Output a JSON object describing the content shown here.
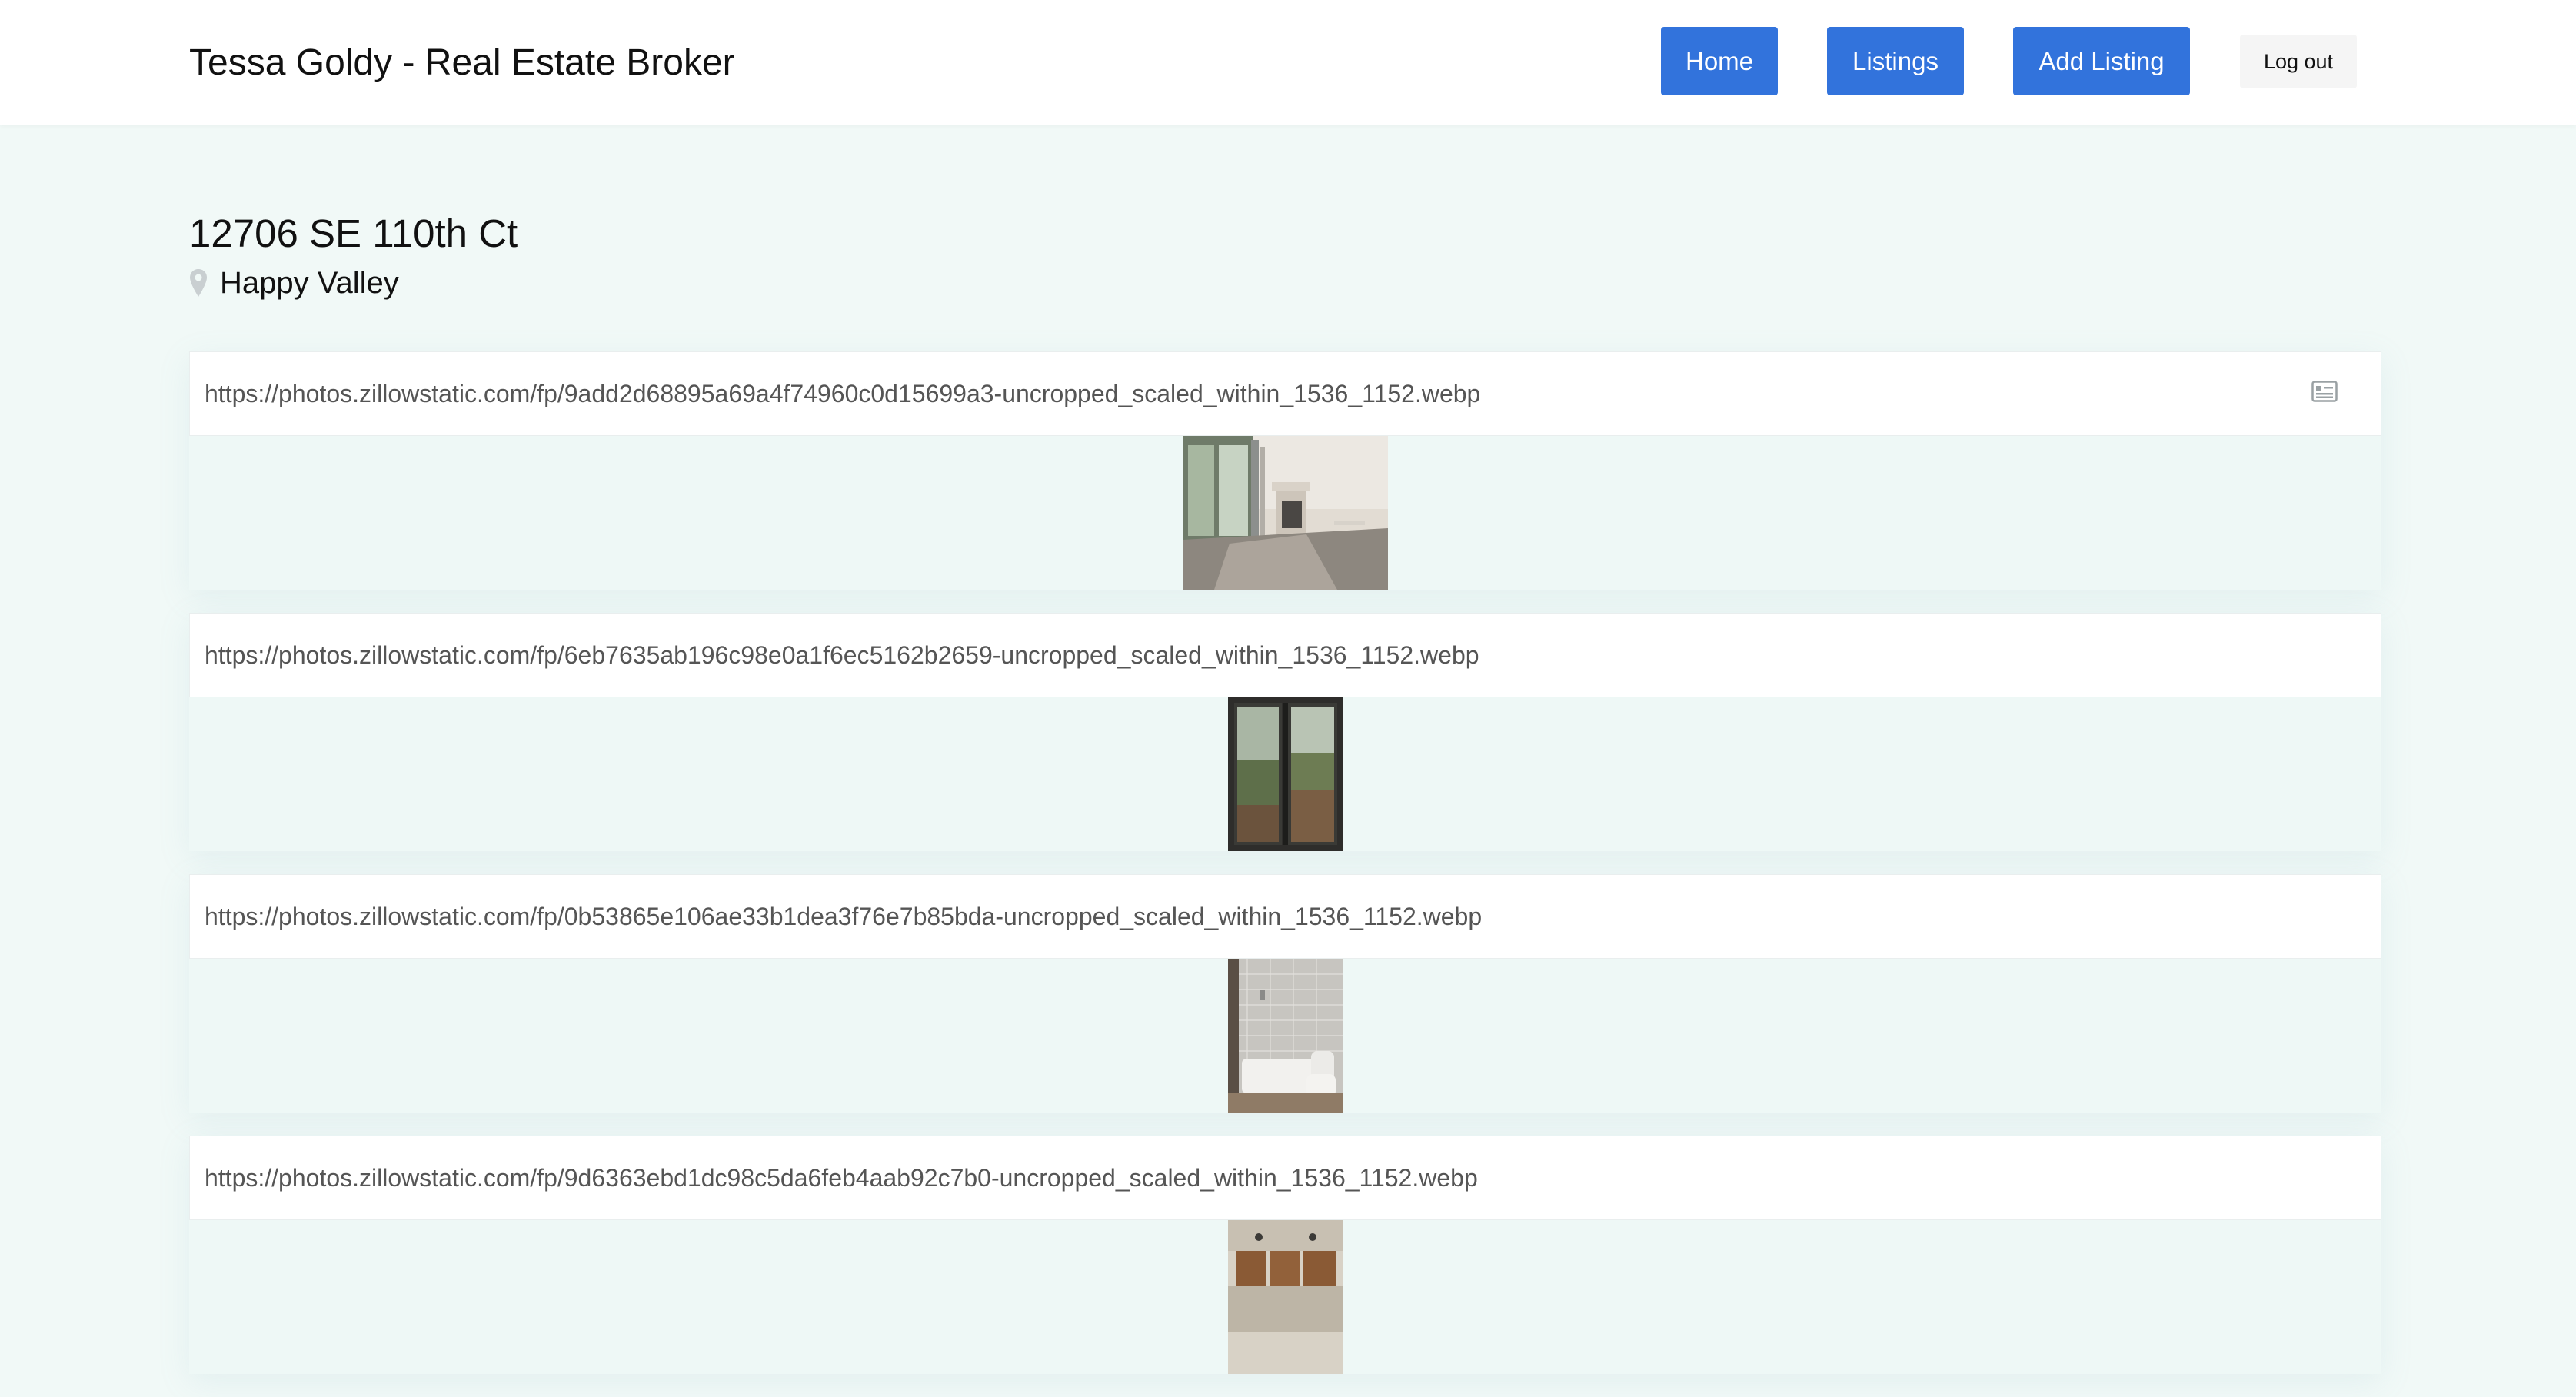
{
  "header": {
    "brand": "Tessa Goldy - Real Estate Broker",
    "nav": {
      "home": "Home",
      "listings": "Listings",
      "add_listing": "Add Listing",
      "logout": "Log out"
    }
  },
  "listing": {
    "address": "12706 SE 110th Ct",
    "city": "Happy Valley",
    "location_icon": "map-pin-icon"
  },
  "photos": [
    {
      "url": "https://photos.zillowstatic.com/fp/9add2d68895a69a4f74960c0d15699a3-uncropped_scaled_within_1536_1152.webp",
      "subject": "living room with fireplace",
      "orientation": "landscape",
      "icon": "id-card-icon"
    },
    {
      "url": "https://photos.zillowstatic.com/fp/6eb7635ab196c98e0a1f6ec5162b2659-uncropped_scaled_within_1536_1152.webp",
      "subject": "sliding door to deck",
      "orientation": "portrait"
    },
    {
      "url": "https://photos.zillowstatic.com/fp/0b53865e106ae33b1dea3f76e7b85bda-uncropped_scaled_within_1536_1152.webp",
      "subject": "bathroom with tiled shower",
      "orientation": "portrait"
    },
    {
      "url": "https://photos.zillowstatic.com/fp/9d6363ebd1dc98c5da6feb4aab92c7b0-uncropped_scaled_within_1536_1152.webp",
      "subject": "kitchen",
      "orientation": "portrait"
    }
  ],
  "colors": {
    "primary_button": "#3273dc",
    "page_background": "#f1f9f7",
    "header_background": "#ffffff"
  }
}
